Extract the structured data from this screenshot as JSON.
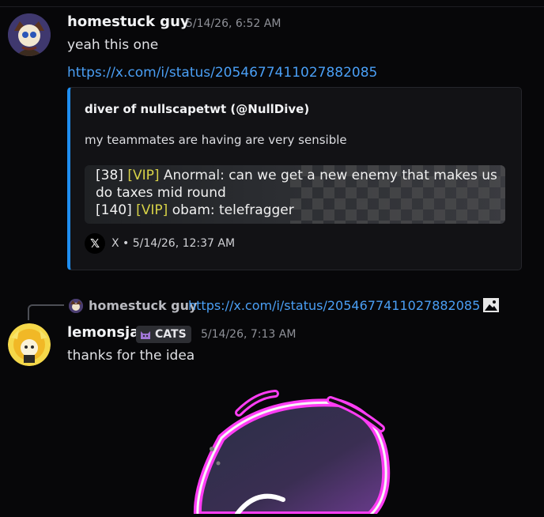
{
  "messages": [
    {
      "author": "homestuck guy",
      "timestamp": "5/14/26, 6:52 AM",
      "text": "yeah this one",
      "link": "https://x.com/i/status/2054677411027882085",
      "embed": {
        "author": "diver of nullscapetwt (@NullDive)",
        "description": "my teammates are having are very sensible",
        "image_chat": [
          {
            "num": "[38]",
            "tag": "[VIP]",
            "user": "Anormal:",
            "text": "can we get a new enemy that makes us"
          },
          {
            "num": "",
            "tag": "",
            "user": "",
            "text": "do taxes mid round"
          },
          {
            "num": "[140]",
            "tag": "[VIP]",
            "user": "obam:",
            "text": "telefragger"
          }
        ],
        "footer": "X • 5/14/26, 12:37 AM",
        "accent_color": "#1f8ef1"
      }
    },
    {
      "reply_to": {
        "author": "homestuck guy",
        "text": "https://x.com/i/status/2054677411027882085"
      },
      "author": "lemonsja",
      "badge": "CATS",
      "timestamp": "5/14/26, 7:13 AM",
      "text": "thanks for the idea"
    }
  ],
  "colors": {
    "background": "#070709",
    "link": "#4a9ff5",
    "vip": "#d7d247"
  }
}
